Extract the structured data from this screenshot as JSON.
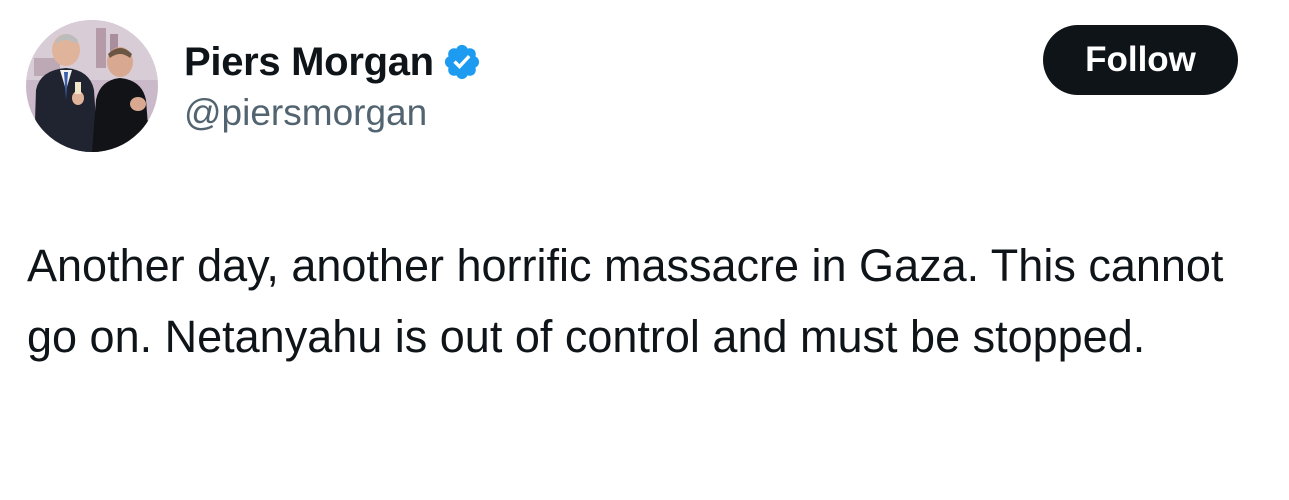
{
  "author": {
    "display_name": "Piers Morgan",
    "handle": "@piersmorgan",
    "verified": true,
    "avatar_icon": "profile-photo"
  },
  "actions": {
    "follow_label": "Follow"
  },
  "tweet": {
    "text": "Another day, another horrific massacre in Gaza. This cannot go on. Netanyahu is out of control and must be stopped."
  },
  "colors": {
    "text_primary": "#0f1419",
    "text_secondary": "#536471",
    "verified_blue": "#1d9bf0",
    "follow_bg": "#0f1419",
    "follow_text": "#ffffff"
  }
}
